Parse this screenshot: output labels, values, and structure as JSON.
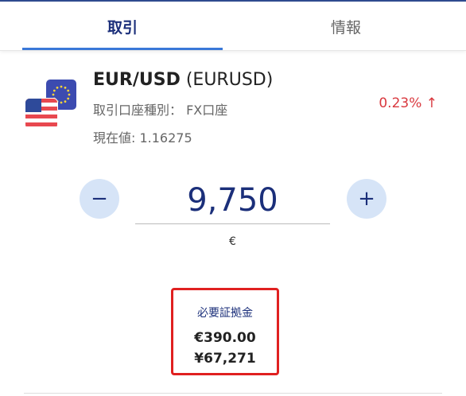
{
  "tabs": [
    {
      "label": "取引",
      "active": true
    },
    {
      "label": "情報",
      "active": false
    }
  ],
  "instrument": {
    "symbol": "EUR/USD",
    "code": "(EURUSD)",
    "account_type": "取引口座種別： FX口座",
    "current_price": "現在値: 1.16275",
    "change": "0.23% ↑"
  },
  "quantity": {
    "minus_label": "−",
    "value": "9,750",
    "plus_label": "+",
    "unit": "€"
  },
  "margin": {
    "label": "必要証拠金",
    "eur": "€390.00",
    "jpy": "¥67,271"
  },
  "colors": {
    "accent": "#3a78d8",
    "brand_navy": "#1b2f7a",
    "positive_change": "#d9383e",
    "highlight_border": "#e02020"
  }
}
